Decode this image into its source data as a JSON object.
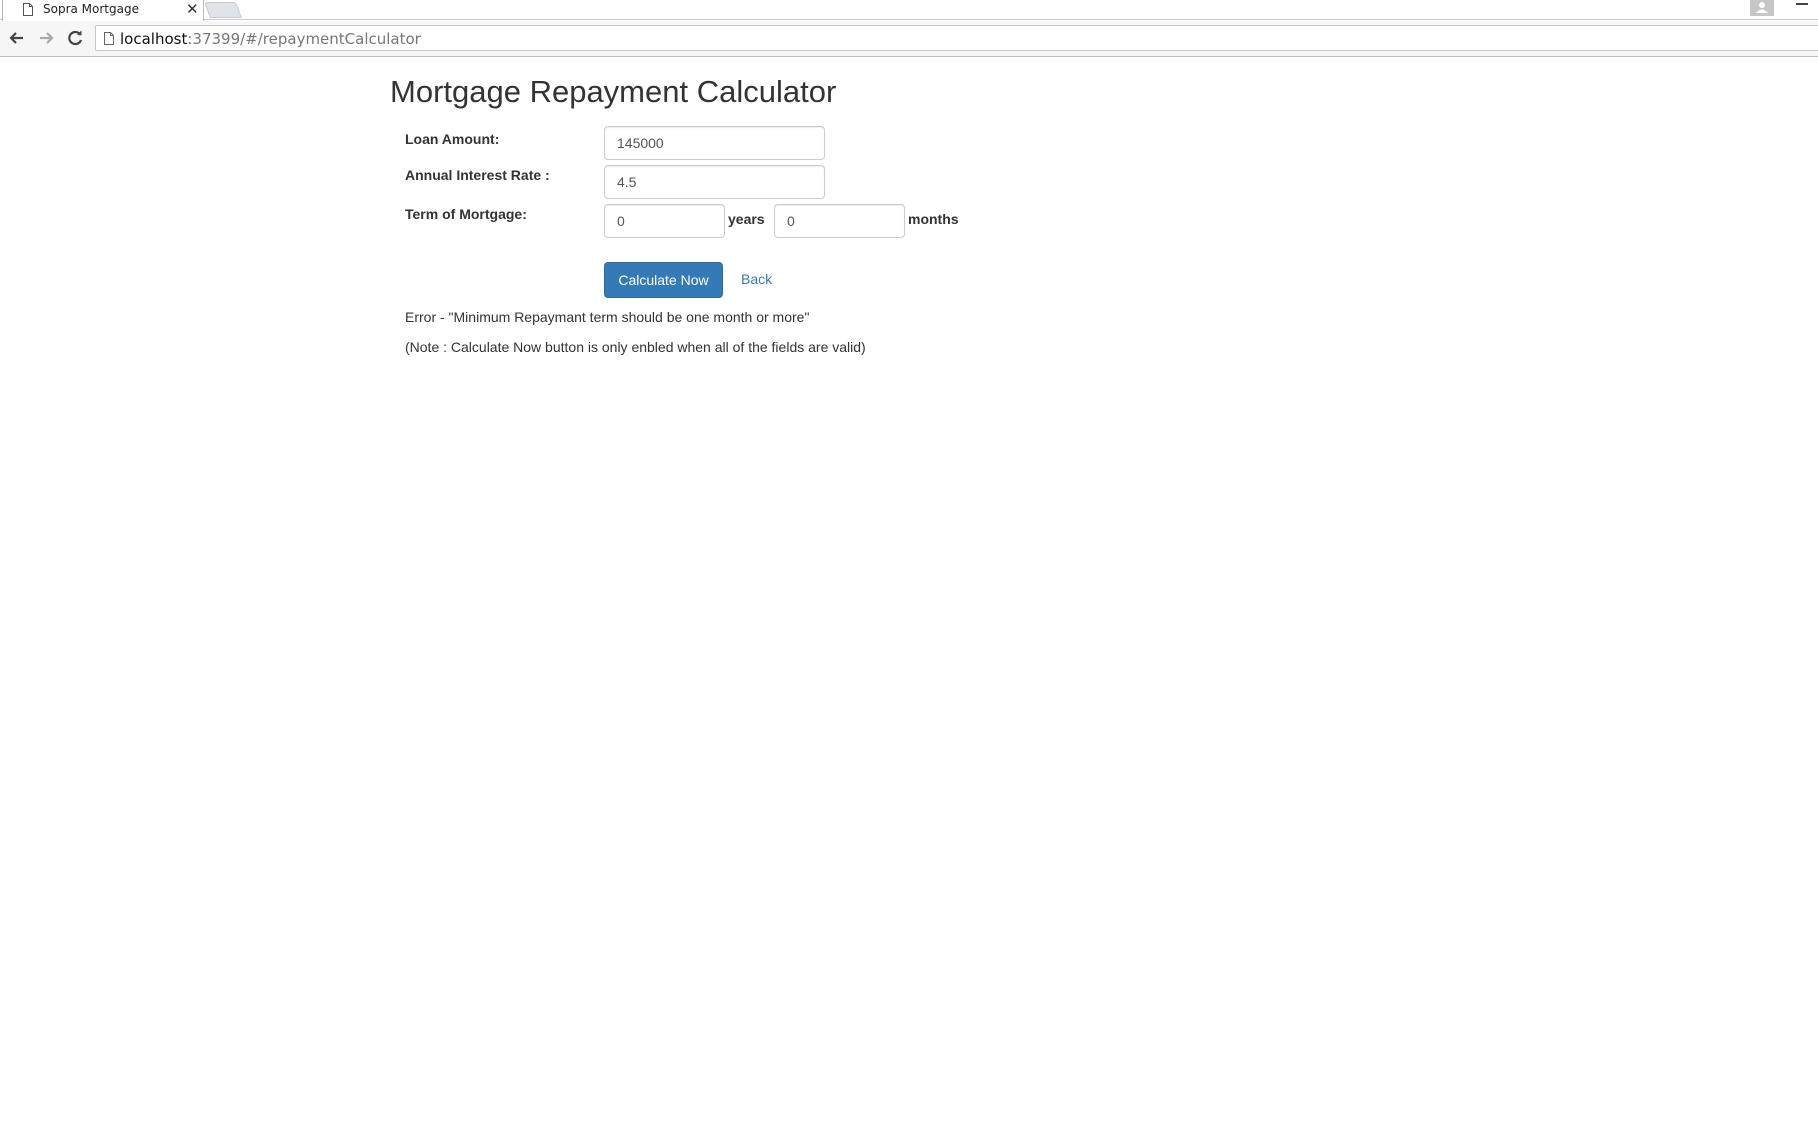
{
  "browser": {
    "tab_title": "Sopra Mortgage",
    "tab_close_glyph": "✕",
    "url_host": "localhost",
    "url_path": ":37399/#/repaymentCalculator",
    "icons": [
      "page-icon",
      "close-icon",
      "new-tab-icon",
      "profile-icon",
      "minimize-icon",
      "back-arrow-icon",
      "forward-arrow-icon",
      "reload-icon"
    ]
  },
  "page": {
    "title": "Mortgage Repayment Calculator",
    "loan_amount": {
      "label": "Loan Amount:",
      "value": "145000"
    },
    "interest_rate": {
      "label": "Annual Interest Rate :",
      "value": "4.5"
    },
    "term": {
      "label": "Term of Mortgage:",
      "years_value": "0",
      "years_unit": "years",
      "months_value": "0",
      "months_unit": "months"
    },
    "calculate_label": "Calculate Now",
    "back_label": "Back",
    "error_message": "Error - \"Minimum Repaymant term should be one month or more\"",
    "note_message": "(Note : Calculate Now button is only enbled when all of the fields are valid)"
  },
  "colors": {
    "primary": "#337ab7",
    "primary_border": "#2e6da4",
    "text": "#333333",
    "input_border": "#cccccc"
  }
}
